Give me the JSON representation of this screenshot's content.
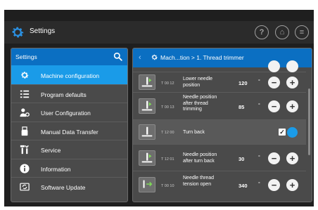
{
  "app": {
    "title": "Settings",
    "colors": {
      "accent": "#0b6fc2",
      "active": "#1a9be8",
      "panel": "#4a4a4a",
      "background": "#1f1f1f"
    },
    "top_icons": [
      {
        "icon": "help-icon",
        "glyph": "?"
      },
      {
        "icon": "home-icon",
        "glyph": "⌂"
      },
      {
        "icon": "menu-icon",
        "glyph": "≡"
      }
    ]
  },
  "sidebar": {
    "header": "Settings",
    "search_icon": "search-icon",
    "items": [
      {
        "label": "Machine configuration",
        "icon": "gear-icon",
        "active": true
      },
      {
        "label": "Program defaults",
        "icon": "grid-icon",
        "active": false
      },
      {
        "label": "User Configuration",
        "icon": "user-gear-icon",
        "active": false
      },
      {
        "label": "Manual Data Transfer",
        "icon": "usb-icon",
        "active": false
      },
      {
        "label": "Service",
        "icon": "tools-icon",
        "active": false
      },
      {
        "label": "Information",
        "icon": "info-icon",
        "active": false
      },
      {
        "label": "Software Update",
        "icon": "update-icon",
        "active": false
      }
    ]
  },
  "main": {
    "breadcrumb": "Mach...tion > 1. Thread trimmer",
    "rows": [
      {
        "code": "T 00 12",
        "name": "Lower needle position",
        "value": "120",
        "unit": "°"
      },
      {
        "code": "T 00 13",
        "name": "Needle position after thread trimming",
        "value": "85",
        "unit": "°"
      },
      {
        "code": "T 12 00",
        "name": "Turn back",
        "checked": true,
        "enabled": true
      },
      {
        "code": "T 12 01",
        "name": "Needle position after turn back",
        "value": "30",
        "unit": "°"
      },
      {
        "code": "T 00 10",
        "name": "Needle thread tension open",
        "value": "340",
        "unit": "°"
      }
    ],
    "minus_label": "−",
    "plus_label": "+",
    "check_glyph": "✓"
  }
}
